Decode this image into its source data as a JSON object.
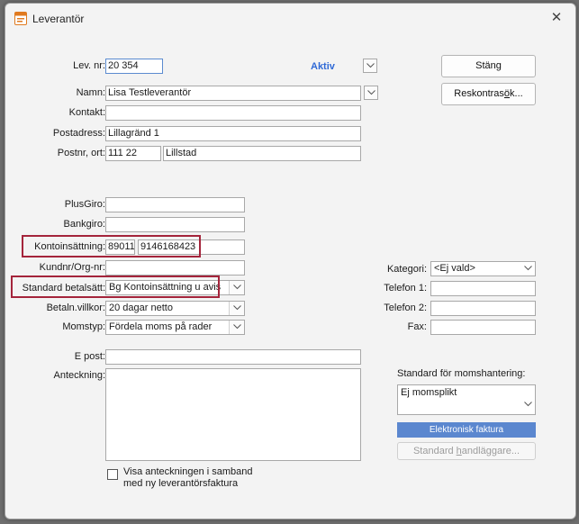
{
  "window": {
    "title": "Leverantör",
    "close_symbol": "✕"
  },
  "labels": {
    "lev_nr": "Lev. nr:",
    "namn": "Namn:",
    "kontakt": "Kontakt:",
    "postadress": "Postadress:",
    "postnr_ort": "Postnr, ort:",
    "plusgiro": "PlusGiro:",
    "bankgiro": "Bankgiro:",
    "kontoinsattning": "Kontoinsättning:",
    "kundnr": "Kundnr/Org-nr:",
    "standard_betalsatt": "Standard betalsätt:",
    "betaln_villkor": "Betaln.villkor:",
    "momstyp": "Momstyp:",
    "epost": "E post:",
    "anteckning": "Anteckning:",
    "kategori": "Kategori:",
    "telefon1": "Telefon 1:",
    "telefon2": "Telefon 2:",
    "fax": "Fax:",
    "standard_moms": "Standard för momshantering:"
  },
  "fields": {
    "lev_nr": "20 354",
    "status": "Aktiv",
    "namn": "Lisa Testleverantör",
    "kontakt": "",
    "postadress": "Lillagränd 1",
    "postnr": "111 22",
    "ort": "Lillstad",
    "plusgiro": "",
    "bankgiro": "",
    "clearing": "89011",
    "kontonr": "9146168423",
    "kundnr": "",
    "standard_betalsatt": "Bg Kontoinsättning u avis",
    "betaln_villkor": "20 dagar netto",
    "momstyp": "Fördela moms på rader",
    "epost": "",
    "anteckning": "",
    "kategori": "<Ej vald>",
    "telefon1": "",
    "telefon2": "",
    "fax": "",
    "standard_moms": "Ej momsplikt"
  },
  "buttons": {
    "stang": "Stäng",
    "reskontra_pre": "Reskontras",
    "reskontra_u": "ö",
    "reskontra_post": "k...",
    "elektronisk_faktura": "Elektronisk faktura",
    "handlaggare_pre": "Standard ",
    "handlaggare_u": "h",
    "handlaggare_post": "andläggare..."
  },
  "checkbox": {
    "label_line1": "Visa anteckningen i samband",
    "label_line2": "med ny leverantörsfaktura",
    "checked": false
  },
  "colors": {
    "accent": "#2f69d6",
    "highlight_box": "#a4243b",
    "primary_button": "#5b87cf"
  }
}
